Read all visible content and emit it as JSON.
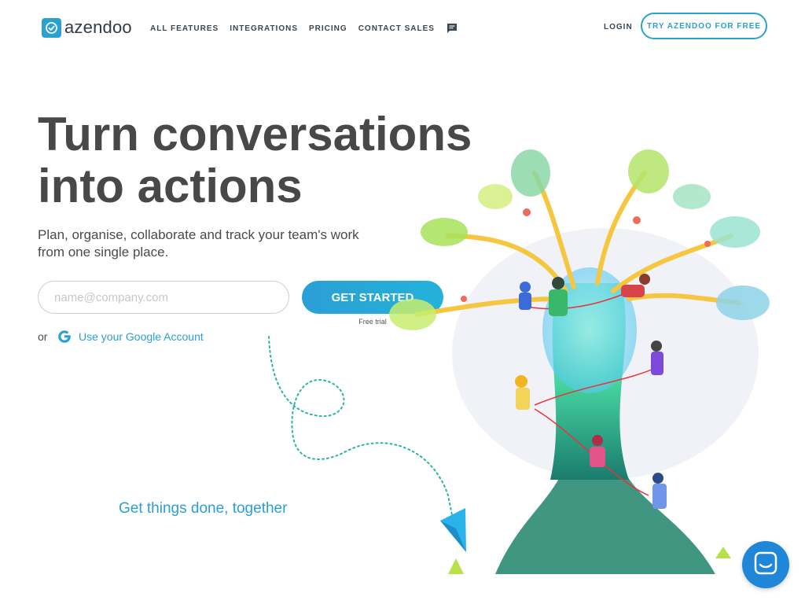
{
  "header": {
    "logo_text": "azendoo",
    "nav": [
      "ALL FEATURES",
      "INTEGRATIONS",
      "PRICING",
      "CONTACT SALES"
    ],
    "login": "LOGIN",
    "cta": "TRY AZENDOO FOR FREE"
  },
  "hero": {
    "headline": "Turn conversations into actions",
    "subhead": "Plan, organise, collaborate and track your team's work from one single place.",
    "email_placeholder": "name@company.com",
    "get_started": "GET STARTED",
    "free_trial": "Free trial",
    "or": "or",
    "google_label": "Use your Google Account",
    "tagline": "Get things done, together"
  },
  "icons": {
    "chat": "chat-bubble-icon",
    "google": "google-icon",
    "messenger": "messenger-icon",
    "logo": "check-icon"
  },
  "colors": {
    "brand": "#2aa2d0",
    "link": "#2a9fd6",
    "text": "#484848",
    "messenger": "#1f86d8"
  }
}
